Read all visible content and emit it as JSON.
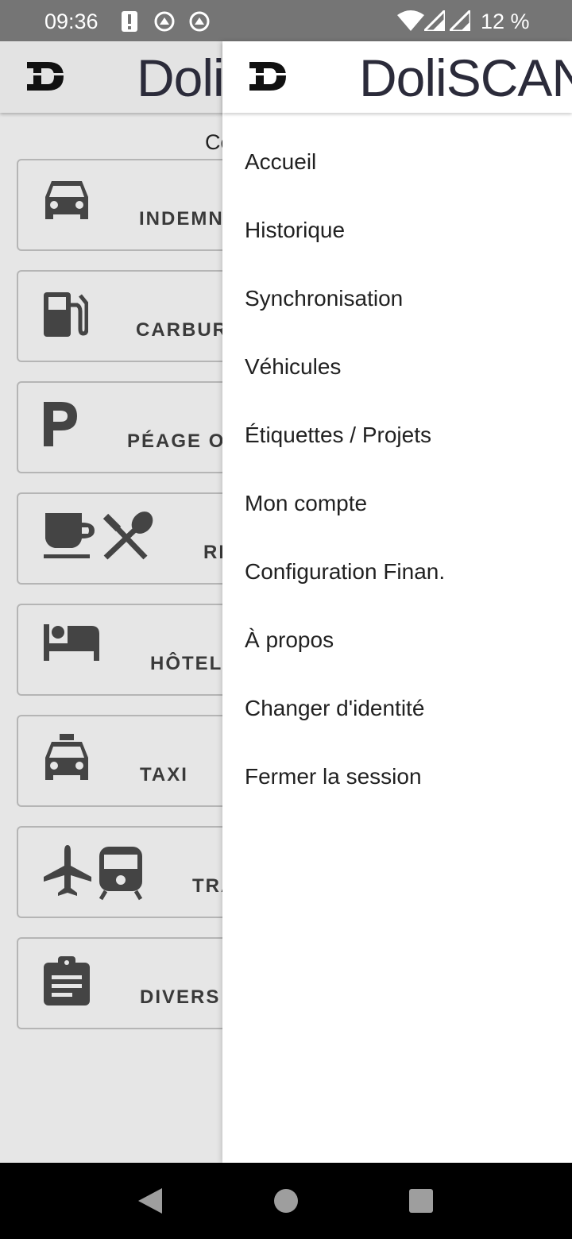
{
  "status_bar": {
    "time": "09:36",
    "battery": "12 %",
    "icons": [
      "alert-icon",
      "sync-icon",
      "sync-icon",
      "wifi-icon",
      "signal-icon",
      "signal-icon"
    ]
  },
  "app": {
    "brand": "DoliSCAN",
    "brand_left": "Doli",
    "brand_right": "SCAN",
    "background_title_fragment": "Co"
  },
  "background_cards": [
    {
      "label": "INDEMN",
      "icon": "car-icon"
    },
    {
      "label": "CARBUR",
      "icon": "fuel-icon"
    },
    {
      "label": "PÉAGE OU",
      "icon": "parking-icon"
    },
    {
      "label": "RE",
      "icon": "meal-icon"
    },
    {
      "label": "HÔTEL",
      "icon": "hotel-bed-icon"
    },
    {
      "label": "TAXI",
      "icon": "taxi-icon"
    },
    {
      "label": "TRA",
      "icon": "plane-train-icon"
    },
    {
      "label": "DIVERS",
      "icon": "clipboard-icon"
    }
  ],
  "menu": {
    "items": [
      "Accueil",
      "Historique",
      "Synchronisation",
      "Véhicules",
      "Étiquettes / Projets",
      "Mon compte",
      "Configuration Finan.",
      "À propos",
      "Changer d'identité",
      "Fermer la session"
    ]
  },
  "nav": {
    "icons": [
      "back-icon",
      "home-icon",
      "recents-icon"
    ]
  },
  "colors": {
    "status_bar": "#757575",
    "scrim_background": "#e6e6e6",
    "drawer": "#ffffff",
    "nav_bar": "#000000",
    "icon_gray": "#444444"
  }
}
